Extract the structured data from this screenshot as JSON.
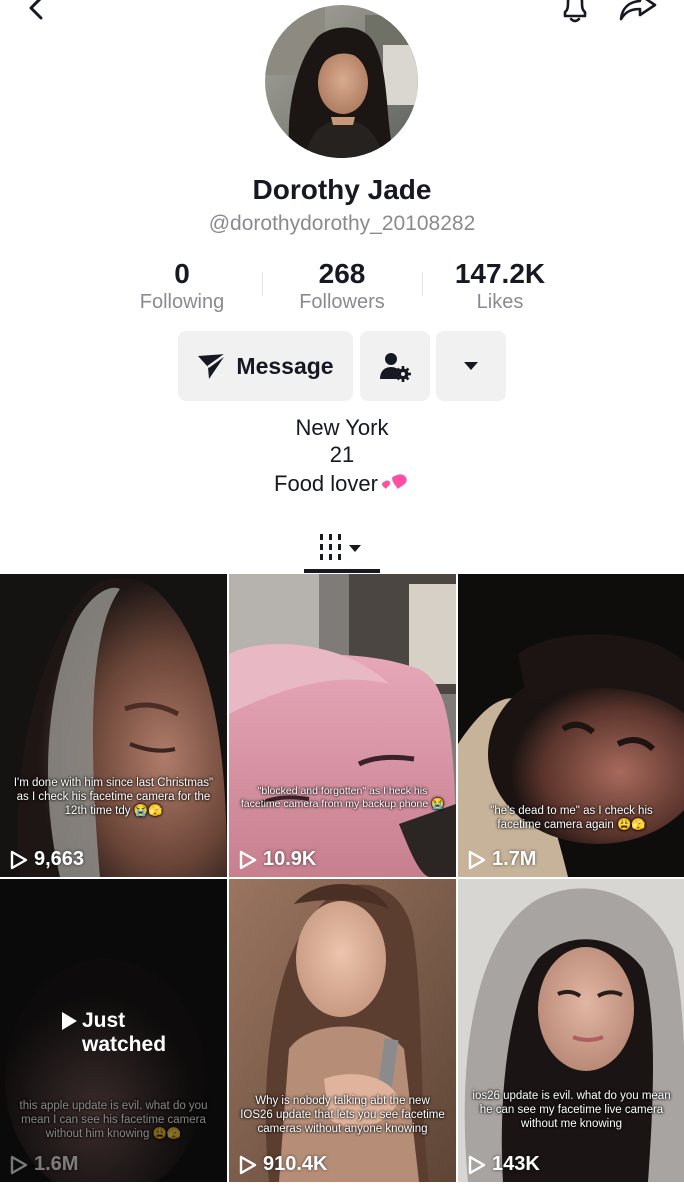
{
  "profile": {
    "display_name": "Dorothy Jade",
    "handle": "@dorothydorothy_20108282"
  },
  "stats": [
    {
      "value": "0",
      "label": "Following"
    },
    {
      "value": "268",
      "label": "Followers"
    },
    {
      "value": "147.2K",
      "label": "Likes"
    }
  ],
  "actions": {
    "message_label": "Message"
  },
  "bio": {
    "line1": "New York",
    "line2": "21",
    "line3": "Food lover"
  },
  "icons": {
    "back": "chevron-left-icon",
    "bell": "bell-icon",
    "share": "share-arrow-icon",
    "message": "send-plane-icon",
    "friend": "person-gear-icon",
    "more": "caret-down-icon",
    "grid": "grid-lines-icon",
    "play": "play-icon",
    "heart": "pink-hearts-emoji"
  },
  "colors": {
    "text": "#161823",
    "secondary": "#8a8b91",
    "button_bg": "#f1f1f2",
    "heart": "#ff4fa3"
  },
  "videos": [
    {
      "caption": "I'm done with him since last Christmas\" as I check his facetime camera for the 12th time tdy 😭🫣",
      "views": "9,663"
    },
    {
      "caption": "\"blocked and forgotten\" as I heck his facetime camera from my backup phone 😭",
      "views": "10.9K"
    },
    {
      "caption": "\"he's dead to me\" as I check his facetime camera again 😩🫣",
      "views": "1.7M"
    },
    {
      "caption": "this apple update is evil. what do you mean I can see his facetime camera without him knowing 😩🫣",
      "views": "1.6M",
      "overlay": "Just watched",
      "overlay_line1": "Just",
      "overlay_line2": "watched"
    },
    {
      "caption": "Why is nobody talking abt the new IOS26 update that lets you see facetime cameras without anyone knowing",
      "views": "910.4K"
    },
    {
      "caption": "ios26 update is evil. what do you mean he can see my facetime live camera without me knowing",
      "views": "143K"
    }
  ]
}
